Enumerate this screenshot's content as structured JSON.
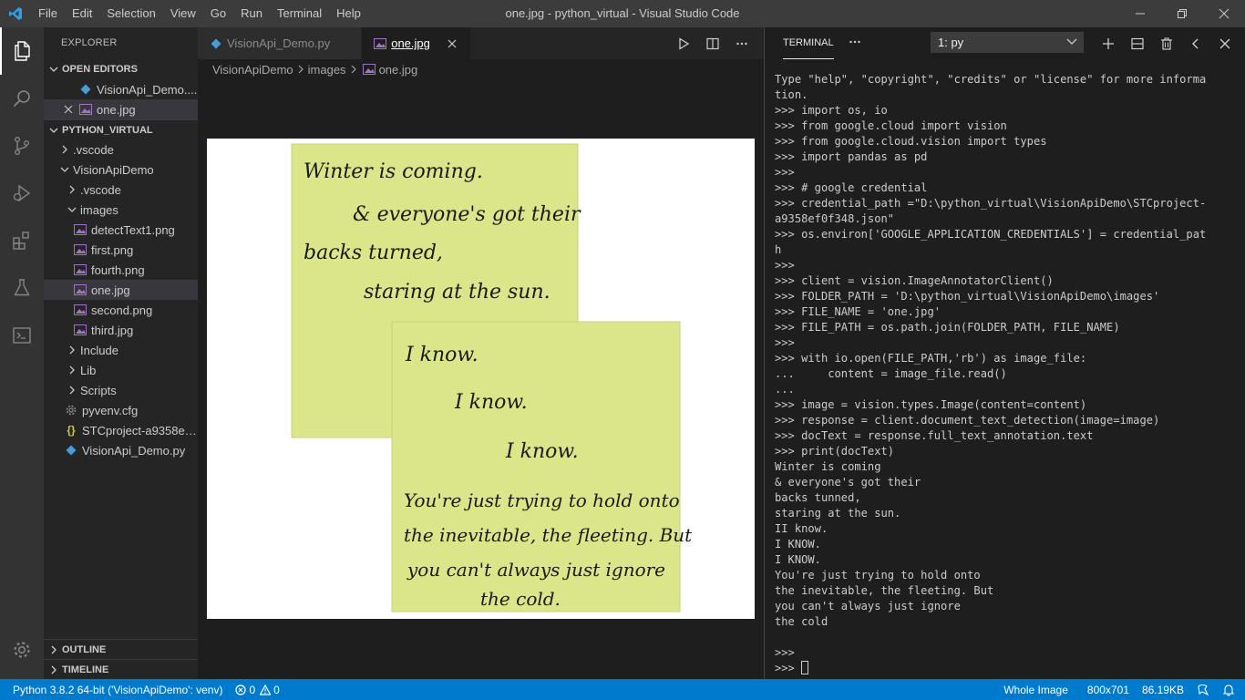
{
  "titlebar": {
    "window_title": "one.jpg - python_virtual - Visual Studio Code",
    "menu": [
      "File",
      "Edit",
      "Selection",
      "View",
      "Go",
      "Run",
      "Terminal",
      "Help"
    ]
  },
  "activity_bar": {
    "items": [
      "files-icon",
      "search-icon",
      "source-control-icon",
      "run-debug-icon",
      "extensions-icon",
      "testing-flask-icon",
      "remote-icon"
    ],
    "bottom": "gear-icon"
  },
  "sidebar": {
    "title": "EXPLORER",
    "open_editors_header": "OPEN EDITORS",
    "open_editors": [
      {
        "label": "VisionApi_Demo....",
        "icon": "python-file-icon"
      },
      {
        "label": "one.jpg",
        "icon": "image-file-icon"
      }
    ],
    "workspace_header": "PYTHON_VIRTUAL",
    "tree": [
      {
        "label": ".vscode"
      },
      {
        "label": "VisionApiDemo"
      },
      {
        "label": ".vscode"
      },
      {
        "label": "images"
      },
      {
        "label": "detectText1.png"
      },
      {
        "label": "first.png"
      },
      {
        "label": "fourth.png"
      },
      {
        "label": "one.jpg"
      },
      {
        "label": "second.png"
      },
      {
        "label": "third.jpg"
      },
      {
        "label": "Include"
      },
      {
        "label": "Lib"
      },
      {
        "label": "Scripts"
      },
      {
        "label": "pyvenv.cfg"
      },
      {
        "label": "STCproject-a9358ef..."
      },
      {
        "label": "VisionApi_Demo.py"
      }
    ],
    "outline_header": "OUTLINE",
    "timeline_header": "TIMELINE"
  },
  "editor": {
    "tabs": [
      {
        "label": "VisionApi_Demo.py"
      },
      {
        "label": "one.jpg"
      }
    ],
    "breadcrumb": [
      "VisionApiDemo",
      "images",
      "one.jpg"
    ],
    "image_note1_lines": [
      "Winter is coming.",
      "& everyone's got their",
      "backs turned,",
      "staring at the sun."
    ],
    "image_note2_lines": [
      "I know.",
      "I know.",
      "I know.",
      "You're just trying to hold onto",
      "the inevitable, the fleeting. But",
      "you can't always just ignore",
      "the cold."
    ]
  },
  "terminal": {
    "tab_label": "TERMINAL",
    "selected_shell": "1: py",
    "lines": [
      "Type \"help\", \"copyright\", \"credits\" or \"license\" for more informa",
      "tion.",
      ">>> import os, io",
      ">>> from google.cloud import vision",
      ">>> from google.cloud.vision import types",
      ">>> import pandas as pd",
      ">>>",
      ">>> # google credential",
      ">>> credential_path =\"D:\\python_virtual\\VisionApiDemo\\STCproject-",
      "a9358ef0f348.json\"",
      ">>> os.environ['GOOGLE_APPLICATION_CREDENTIALS'] = credential_pat",
      "h",
      ">>>",
      ">>> client = vision.ImageAnnotatorClient()",
      ">>> FOLDER_PATH = 'D:\\python_virtual\\VisionApiDemo\\images'",
      ">>> FILE_NAME = 'one.jpg'",
      ">>> FILE_PATH = os.path.join(FOLDER_PATH, FILE_NAME)",
      ">>>",
      ">>> with io.open(FILE_PATH,'rb') as image_file:",
      "...     content = image_file.read()",
      "...",
      ">>> image = vision.types.Image(content=content)",
      ">>> response = client.document_text_detection(image=image)",
      ">>> docText = response.full_text_annotation.text",
      ">>> print(docText)",
      "Winter is coming",
      "& everyone's got their",
      "backs tunned,",
      "staring at the sun.",
      "II know.",
      "I KNOW.",
      "I KNOW.",
      "You're just trying to hold onto",
      "the inevitable, the fleeting. But",
      "you can't always just ignore",
      "the cold",
      "",
      ">>>",
      ">>> "
    ]
  },
  "statusbar": {
    "interpreter": "Python 3.8.2 64-bit ('VisionApiDemo': venv)",
    "errors": "0",
    "warnings": "0",
    "zoom": "Whole Image",
    "dimensions": "800x701",
    "filesize": "86.19KB"
  },
  "colors": {
    "accent": "#007acc",
    "sticky_note": "#dbe68a"
  }
}
